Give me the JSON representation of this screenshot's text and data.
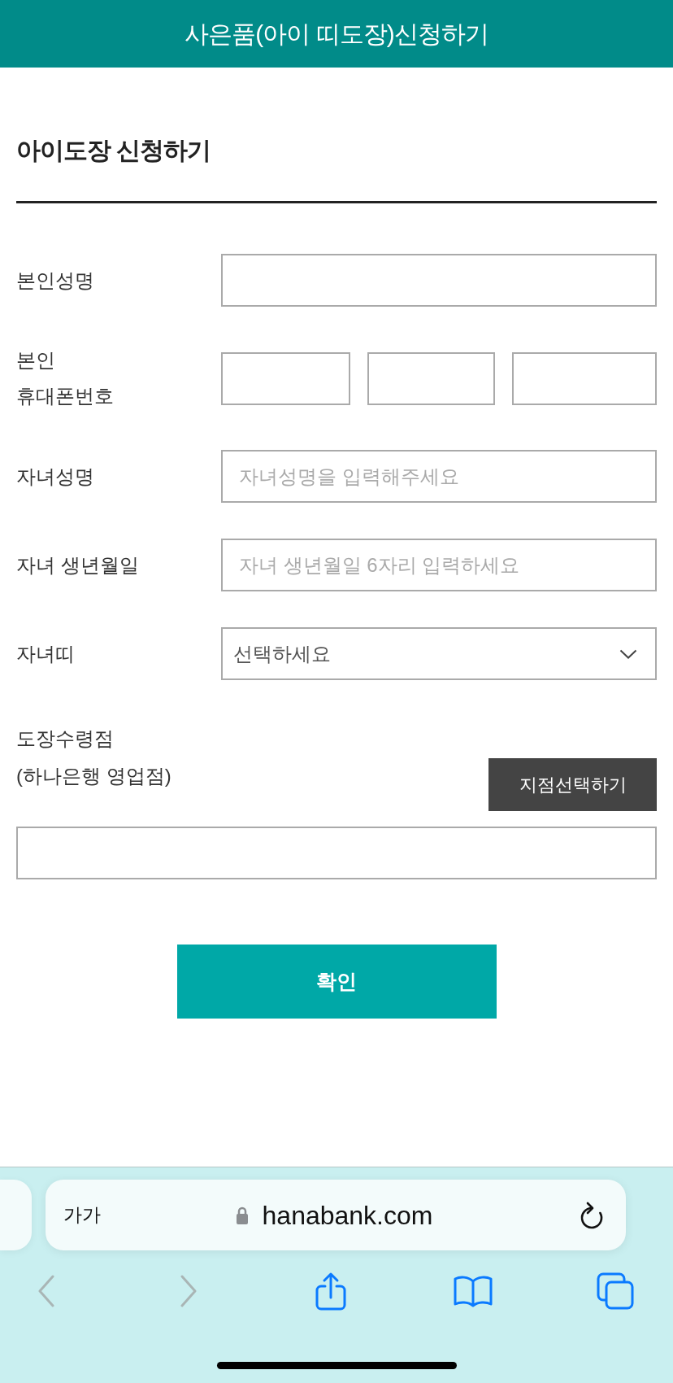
{
  "header": {
    "title": "사은품(아이 띠도장)신청하기"
  },
  "form": {
    "title": "아이도장 신청하기",
    "fields": [
      {
        "kind": "text",
        "label": "본인성명"
      },
      {
        "kind": "phone",
        "label": "본인\n휴대폰번호"
      },
      {
        "kind": "text",
        "label": "자녀성명",
        "placeholder": "자녀성명을 입력해주세요"
      },
      {
        "kind": "text",
        "label": "자녀 생년월일",
        "placeholder": "자녀 생년월일 6자리 입력하세요"
      },
      {
        "kind": "select",
        "label": "자녀띠",
        "value": "선택하세요"
      },
      {
        "kind": "branch",
        "label": "도장수령점\n(하나은행 영업점)",
        "button": "지점선택하기"
      }
    ],
    "submit": "확인"
  },
  "browser": {
    "text_size_button": "가가",
    "url": "hanabank.com",
    "nav": [
      {
        "kind": "back",
        "disabled": true
      },
      {
        "kind": "forward",
        "disabled": true
      },
      {
        "kind": "share",
        "disabled": false
      },
      {
        "kind": "bookmarks",
        "disabled": false
      },
      {
        "kind": "tabs",
        "disabled": false
      }
    ]
  }
}
